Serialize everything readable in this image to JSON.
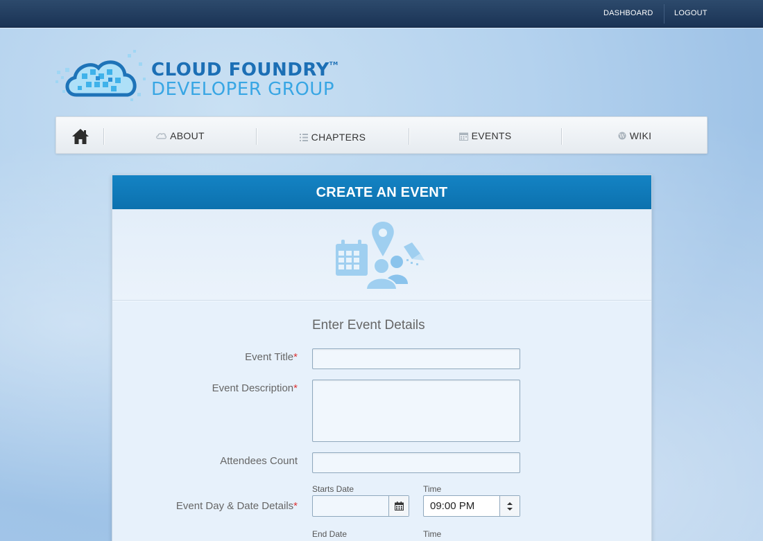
{
  "topbar": {
    "dashboard_label": "DASHBOARD",
    "logout_label": "LOGOUT"
  },
  "logo": {
    "line1": "CLOUD FOUNDRY",
    "tm": "TM",
    "line2": "DEVELOPER GROUP"
  },
  "nav": {
    "home_icon": "home-icon",
    "items": [
      {
        "label": "ABOUT",
        "icon": "cloud-icon"
      },
      {
        "label": "CHAPTERS",
        "icon": "list-icon"
      },
      {
        "label": "EVENTS",
        "icon": "calendar-icon"
      },
      {
        "label": "WIKI",
        "icon": "wordpress-icon"
      }
    ]
  },
  "panel": {
    "title": "CREATE AN EVENT",
    "hero_icon": "event-illustration-icon",
    "form_title": "Enter Event Details"
  },
  "form": {
    "event_title": {
      "label": "Event Title",
      "required": "*",
      "value": ""
    },
    "event_description": {
      "label": "Event Description",
      "required": "*",
      "value": ""
    },
    "attendees_count": {
      "label": "Attendees Count",
      "value": ""
    },
    "day_date": {
      "label": "Event Day & Date Details",
      "required": "*",
      "starts_date_label": "Starts Date",
      "starts_date_value": "",
      "start_time_label": "Time",
      "start_time_value": "09:00 PM",
      "end_date_label": "End Date",
      "end_time_label": "Time"
    }
  },
  "colors": {
    "topbar": "#1f3a5e",
    "panel_header": "#0f79b9",
    "required": "#dd3333",
    "logo_dark": "#1c6fb5",
    "logo_light": "#38a6e4"
  }
}
